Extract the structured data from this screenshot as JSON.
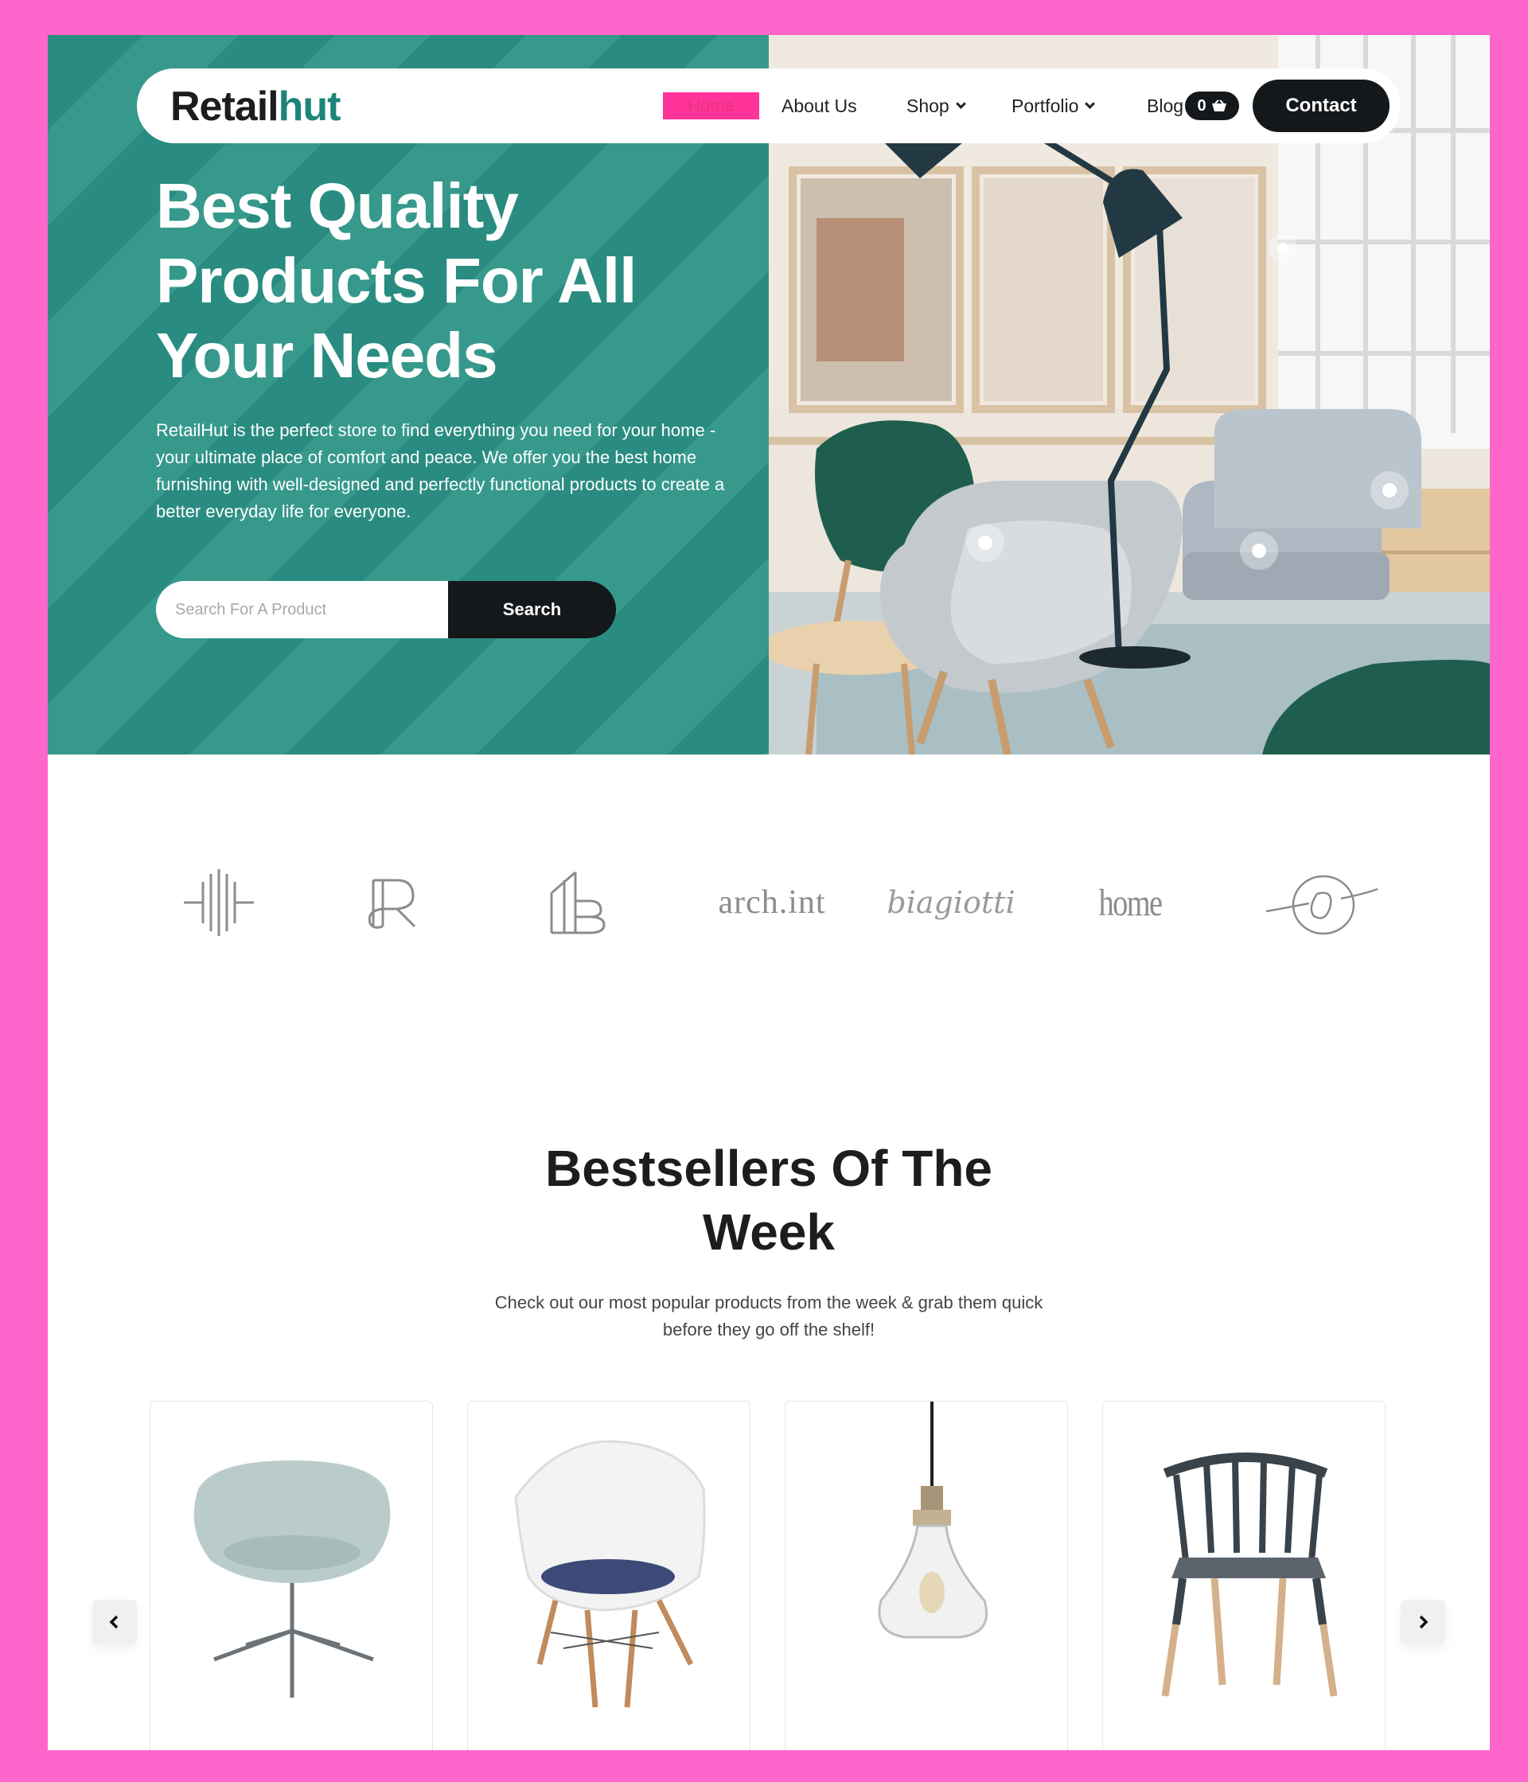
{
  "brand": {
    "logo_part1": "Retail",
    "logo_part2": "hut"
  },
  "nav": {
    "home": "Home",
    "about": "About Us",
    "shop": "Shop",
    "portfolio": "Portfolio",
    "blog": "Blog",
    "cart_count": "0",
    "contact": "Contact"
  },
  "hero": {
    "title_line1": "Best Quality",
    "title_line2": "Products For All",
    "title_line3": "Your Needs",
    "description": "RetailHut is the perfect store to find everything you need for your home - your ultimate place of comfort and peace. We offer you the best home furnishing with well-designed and perfectly functional products to create a better everyday life for everyone.",
    "search_placeholder": "Search For A Product",
    "search_button": "Search"
  },
  "brands": {
    "logos": [
      "pillars-logo",
      "r-monogram-logo",
      "building-b-logo",
      "arch.int",
      "biagiotti",
      "home",
      "o-script-logo"
    ],
    "arch": "arch.int",
    "biagiotti": "biagiotti",
    "home": "home"
  },
  "bestsellers": {
    "title_line1": "Bestsellers Of The",
    "title_line2": "Week",
    "description": "Check out our most popular products from the week & grab them quick before they go off the shelf!",
    "products": [
      "lounge-chair",
      "eames-chair",
      "pendant-lamp",
      "spindle-chair"
    ]
  },
  "colors": {
    "accent_teal": "#2a8c80",
    "brand_pink": "#ff66cc",
    "dark": "#15181b",
    "home_highlight": "#ff3399"
  }
}
